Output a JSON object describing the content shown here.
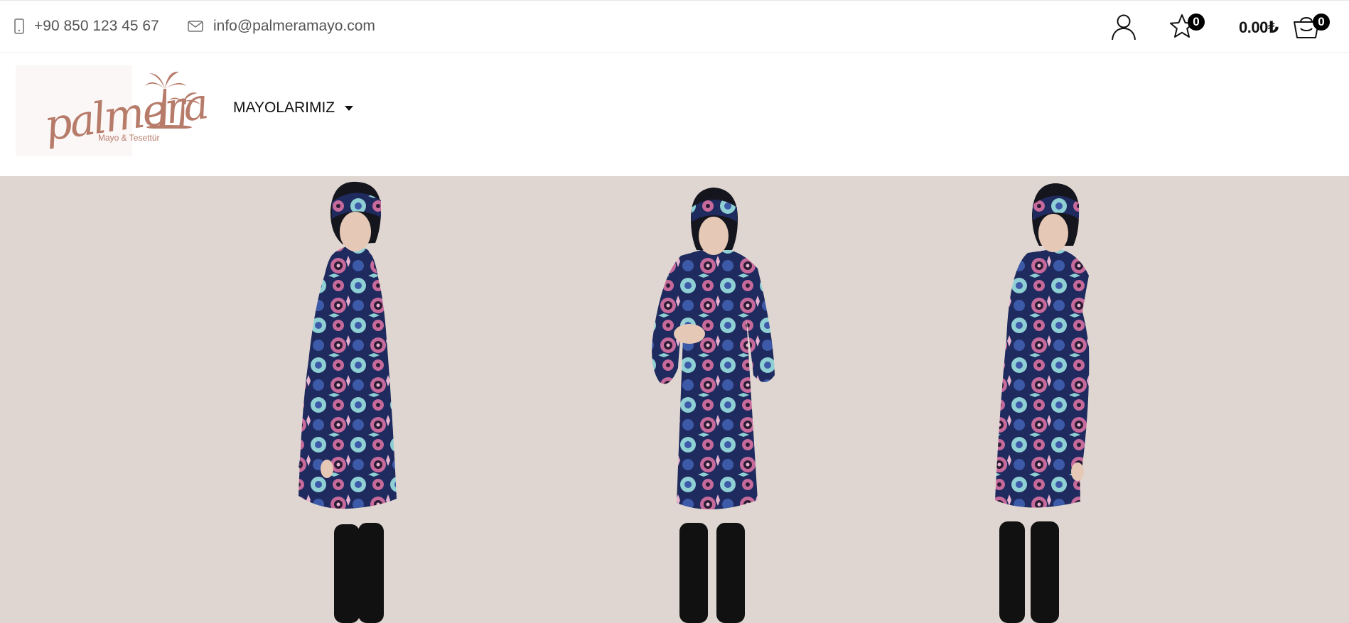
{
  "contact": {
    "phone": "+90 850 123 45 67",
    "email": "info@palmeramayo.com",
    "phone_icon": "mobile-icon",
    "email_icon": "envelope-icon"
  },
  "tools": {
    "user_icon": "user-icon",
    "wishlist_icon": "star-icon",
    "wishlist_count": "0",
    "cart_total": "0.00₺",
    "cart_icon": "shopping-basket-icon",
    "cart_count": "0"
  },
  "logo": {
    "wordmark": "palmera",
    "tagline": "Mayo & Tesettür"
  },
  "nav": {
    "items": [
      {
        "label": "MAYOLARIMIZ",
        "has_dropdown": true
      }
    ]
  },
  "hero": {
    "background": "#dfd6d1",
    "pattern_colors": [
      "#1f2a5e",
      "#3d5aa8",
      "#c66a9b",
      "#8fd0d4",
      "#2b1b34"
    ]
  }
}
